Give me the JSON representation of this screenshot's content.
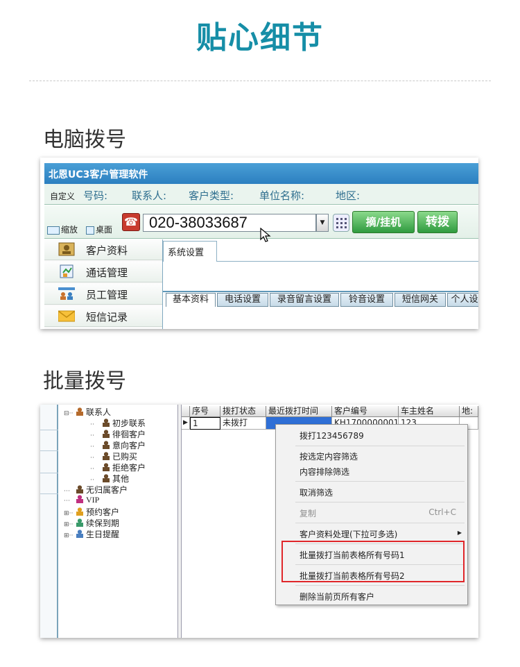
{
  "hero_title": "贴心细节",
  "section1_title": "电脑拨号",
  "section2_title": "批量拨号",
  "app": {
    "title": "北恩UC3客户管理软件",
    "custom_label": "自定义",
    "fields": [
      "号码:",
      "联系人:",
      "客户类型:",
      "单位名称:",
      "地区:"
    ],
    "zoom_label": "缩放",
    "desktop_label": "桌面",
    "phone_number": "020-38033687",
    "hangup_label": "摘/挂机",
    "transfer_label": "转拨",
    "nav": [
      "客户资料",
      "通话管理",
      "员工管理",
      "短信记录"
    ],
    "top_tab": "系统设置",
    "bottom_tabs": [
      "基本资料",
      "电话设置",
      "录音留言设置",
      "铃音设置",
      "短信网关",
      "个人设"
    ]
  },
  "batch": {
    "tree": [
      {
        "label": "联系人",
        "prefix": "⊟",
        "level": 0
      },
      {
        "label": "初步联系",
        "prefix": "",
        "level": 1
      },
      {
        "label": "徘徊客户",
        "prefix": "",
        "level": 1
      },
      {
        "label": "意向客户",
        "prefix": "",
        "level": 1
      },
      {
        "label": "已购买",
        "prefix": "",
        "level": 1
      },
      {
        "label": "拒绝客户",
        "prefix": "",
        "level": 1
      },
      {
        "label": "其他",
        "prefix": "",
        "level": 1
      },
      {
        "label": "无归属客户",
        "prefix": "",
        "level": 0
      },
      {
        "label": "VIP",
        "prefix": "",
        "level": 0
      },
      {
        "label": "预约客户",
        "prefix": "⊞",
        "level": 0
      },
      {
        "label": "续保到期",
        "prefix": "⊞",
        "level": 0
      },
      {
        "label": "生日提醒",
        "prefix": "⊞",
        "level": 0
      }
    ],
    "columns": [
      "序号",
      "拨打状态",
      "最近拨打时间",
      "客户编号",
      "车主姓名",
      "地:"
    ],
    "row": {
      "index": "1",
      "status": "未拨打",
      "time": "",
      "customer_no": "KH1700000001",
      "owner": "123"
    },
    "menu": {
      "dial": "拨打123456789",
      "filter_selected": "按选定内容筛选",
      "filter_exclude": "内容排除筛选",
      "cancel_filter": "取消筛选",
      "copy": "复制",
      "copy_shortcut": "Ctrl+C",
      "process": "客户资料处理(下拉可多选)",
      "batch1": "批量拨打当前表格所有号码1",
      "batch2": "批量拨打当前表格所有号码2",
      "delete": "删除当前页所有客户"
    }
  },
  "colors": {
    "brand": "#168ea7",
    "highlight": "#e0262a",
    "green": "#2f9b3f"
  }
}
